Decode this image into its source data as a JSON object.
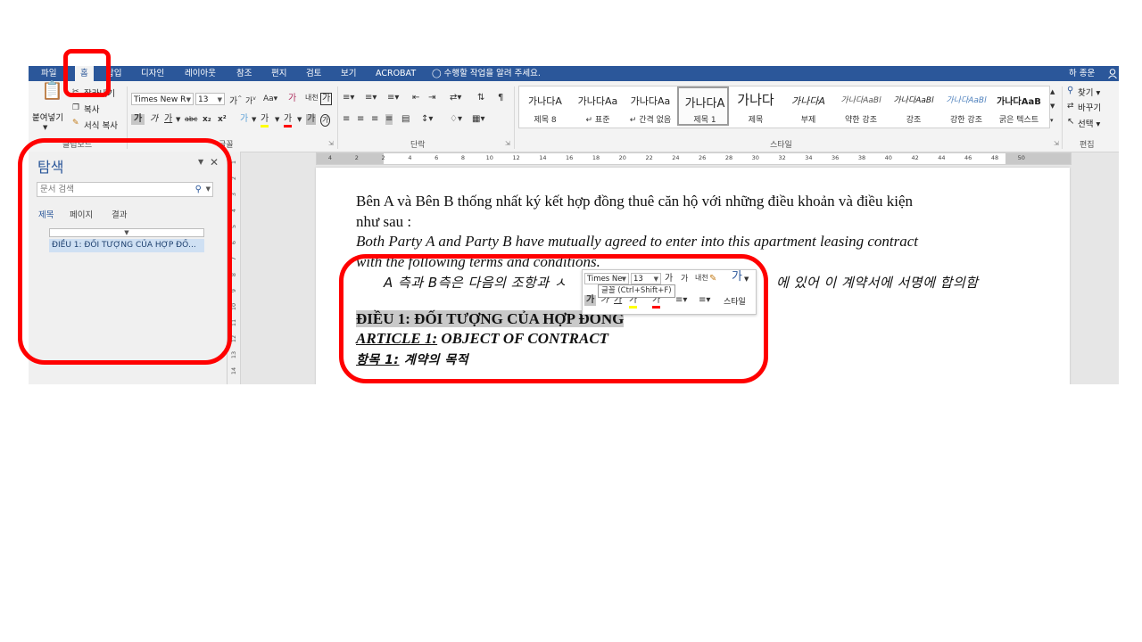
{
  "tabs": [
    "파일",
    "홈",
    "삽입",
    "디자인",
    "레이아웃",
    "참조",
    "편지",
    "검토",
    "보기",
    "ACROBAT"
  ],
  "tell_me": "수행할 작업을 알려 주세요.",
  "user": "하 종운",
  "clipboard": {
    "paste": "붙여넣기",
    "cut": "잘라내기",
    "copy": "복사",
    "format_painter": "서식 복사",
    "label": "클립보드"
  },
  "font": {
    "name": "Times New R",
    "size": "13",
    "label": "글꼴",
    "grow": "가",
    "shrink": "가",
    "case": "Aa",
    "clear": "가",
    "phonetic": "내천",
    "border": "가",
    "bold": "가",
    "italic": "가",
    "underline": "가",
    "strike": "abc",
    "sub": "x₂",
    "sup": "x²",
    "effects": "가",
    "highlight": "가",
    "color": "가",
    "shade": "가",
    "enclose": "가"
  },
  "paragraph": {
    "label": "단락"
  },
  "styles": {
    "label": "스타일",
    "items": [
      {
        "preview": "가나다A",
        "name": "제목 8"
      },
      {
        "preview": "가나다Aa",
        "name": "표준"
      },
      {
        "preview": "가나다Aa",
        "name": "간격 없음"
      },
      {
        "preview": "가나다A",
        "name": "제목 1"
      },
      {
        "preview": "가나다",
        "name": "제목"
      },
      {
        "preview": "가나다A",
        "name": "부제"
      },
      {
        "preview": "가나다AaBl",
        "name": "약한 강조"
      },
      {
        "preview": "가나다AaBl",
        "name": "강조"
      },
      {
        "preview": "가나다AaBl",
        "name": "강한 강조"
      },
      {
        "preview": "가나다AaB",
        "name": "굵은 텍스트"
      }
    ]
  },
  "editing": {
    "label": "편집",
    "find": "찾기",
    "replace": "바꾸기",
    "select": "선택"
  },
  "nav": {
    "title": "탐색",
    "search_placeholder": "문서 검색",
    "tabs": [
      "제목",
      "페이지",
      "결과"
    ],
    "heading_item": "ĐIỀU 1: ĐỐI TƯỢNG CỦA HỢP ĐỒ..."
  },
  "ruler": {
    "h_ticks": [
      "4",
      "2",
      "2",
      "4",
      "6",
      "8",
      "10",
      "12",
      "14",
      "16",
      "18",
      "20",
      "22",
      "24",
      "26",
      "28",
      "30",
      "32",
      "34",
      "36",
      "38",
      "40",
      "42",
      "44",
      "46",
      "48",
      "50"
    ],
    "v_ticks": [
      "1",
      "2",
      "3",
      "4",
      "5",
      "6",
      "7",
      "8",
      "9",
      "10",
      "11",
      "12",
      "13",
      "14"
    ]
  },
  "document": {
    "line1": "Bên A và Bên B thống nhất ký kết hợp đồng thuê căn hộ với những điều khoản và điều kiện",
    "line2": "như sau :",
    "line3": "Both Party A and Party B have mutually agreed to enter into this apartment leasing contract",
    "line4": "with the following terms and conditions.",
    "line5_a": "A 측과 B측은 다음의 조항과 ㅅ",
    "line5_b": "에 있어 이 계약서에 서명에 합의함",
    "heading_vi": "ĐIỀU 1: ĐỐI TƯỢNG CỦA HỢP ĐỒNG",
    "heading_en_a": "ARTICLE 1:",
    "heading_en_b": " OBJECT OF CONTRACT",
    "heading_ko_a": "항목 1:",
    "heading_ko_b": " 계약의 목적"
  },
  "mini_toolbar": {
    "font": "Times Ne",
    "size": "13",
    "styles": "스타일",
    "tooltip": "글꼴 (Ctrl+Shift+F)"
  },
  "colors": {
    "accent": "#2b579a",
    "annotation": "#ff0000",
    "highlight_yellow": "#ffff00",
    "font_red": "#ff0000"
  }
}
